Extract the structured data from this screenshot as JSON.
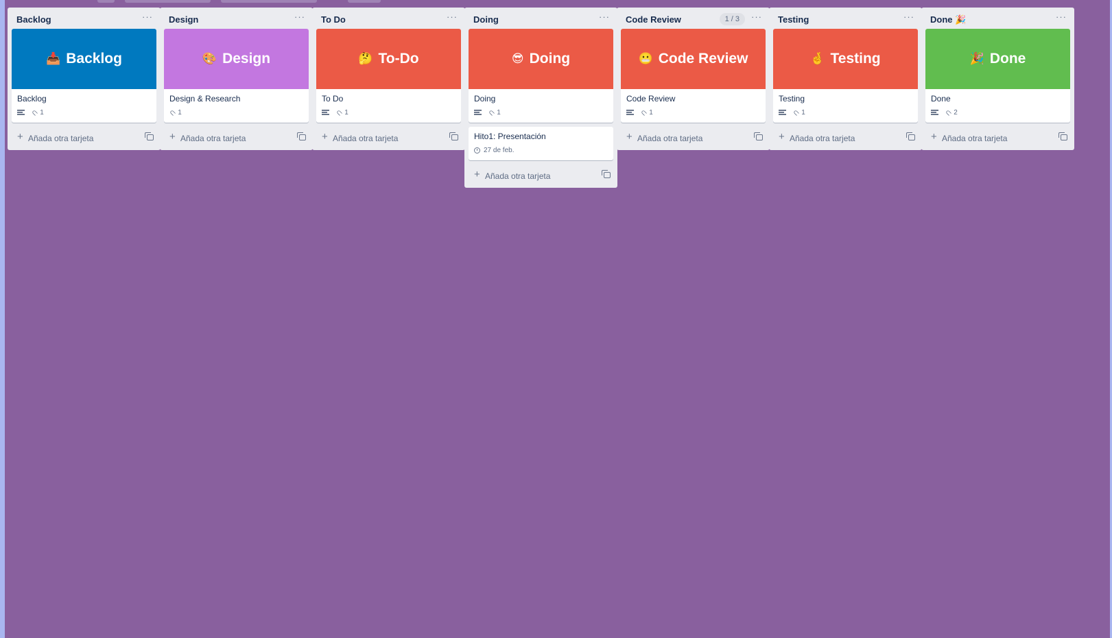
{
  "colors": {
    "board_background": "#89609e",
    "list_background": "#ebecf0",
    "cover_blue": "#0079bf",
    "cover_purple": "#c377e0",
    "cover_red": "#eb5a46",
    "cover_green": "#61bd4f"
  },
  "add_card_label": "Añada otra tarjeta",
  "lists": [
    {
      "title": "Backlog",
      "cover": {
        "emoji": "📥",
        "text": "Backlog",
        "color": "#0079bf"
      },
      "card": {
        "title": "Backlog",
        "has_description": true,
        "attachments": "1"
      }
    },
    {
      "title": "Design",
      "cover": {
        "emoji": "🎨",
        "text": "Design",
        "color": "#c377e0"
      },
      "card": {
        "title": "Design & Research",
        "has_description": false,
        "attachments": "1"
      }
    },
    {
      "title": "To Do",
      "cover": {
        "emoji": "🤔",
        "text": "To-Do",
        "color": "#eb5a46"
      },
      "card": {
        "title": "To Do",
        "has_description": true,
        "attachments": "1"
      }
    },
    {
      "title": "Doing",
      "cover": {
        "emoji": "😎",
        "text": "Doing",
        "color": "#eb5a46"
      },
      "card": {
        "title": "Doing",
        "has_description": true,
        "attachments": "1"
      },
      "extra_card": {
        "title": "Hito1: Presentación",
        "due": "27 de feb."
      }
    },
    {
      "title": "Code Review",
      "badge": "1 / 3",
      "cover": {
        "emoji": "😬",
        "text": "Code Review",
        "color": "#eb5a46"
      },
      "card": {
        "title": "Code Review",
        "has_description": true,
        "attachments": "1"
      }
    },
    {
      "title": "Testing",
      "cover": {
        "emoji": "🤞",
        "text": "Testing",
        "color": "#eb5a46"
      },
      "card": {
        "title": "Testing",
        "has_description": true,
        "attachments": "1"
      }
    },
    {
      "title": "Done",
      "title_emoji": "🎉",
      "cover": {
        "emoji": "🎉",
        "text": "Done",
        "color": "#61bd4f"
      },
      "card": {
        "title": "Done",
        "has_description": true,
        "attachments": "2"
      }
    }
  ]
}
